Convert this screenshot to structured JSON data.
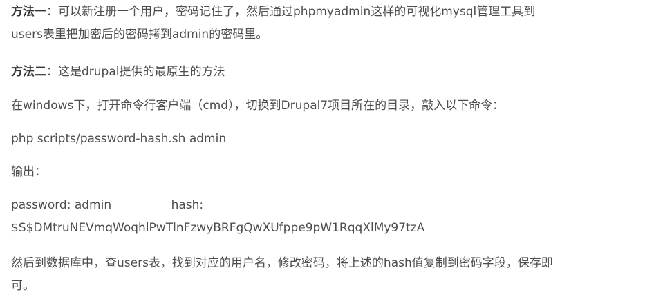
{
  "article": {
    "method1": {
      "label": "方法一",
      "text_line1": "：可以新注册一个用户，密码记住了，然后通过phpmyadmin这样的可视化mysql管理工具到",
      "text_line2": "users表里把加密后的密码拷到admin的密码里。"
    },
    "method2": {
      "label": "方法二",
      "text": "：这是drupal提供的最原生的方法"
    },
    "instruction": "在windows下，打开命令行客户端（cmd），切换到Drupal7项目所在的目录，敲入以下命令：",
    "command": "php scripts/password-hash.sh admin",
    "output_label": "输出：",
    "output": {
      "line1": "password: admin                hash:",
      "line2": "$S$DMtruNEVmqWoqhlPwTlnFzwyBRFgQwXUfppe9pW1RqqXlMy97tzA"
    },
    "conclusion": {
      "line1": "然后到数据库中，查users表，找到对应的用户名，修改密码，将上述的hash值复制到密码字段，保存即",
      "line2": "可。"
    }
  }
}
